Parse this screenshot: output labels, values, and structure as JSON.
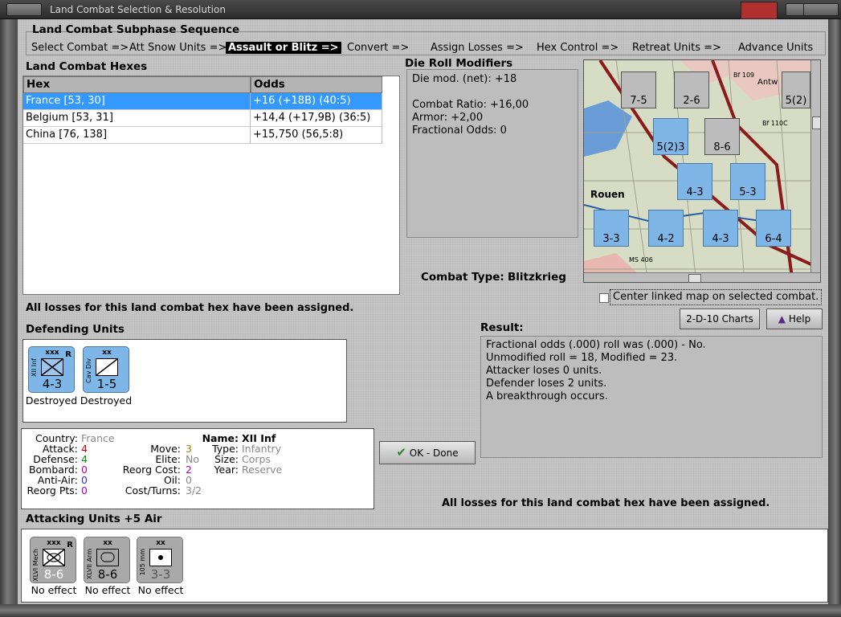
{
  "window": {
    "title": "Land Combat Selection & Resolution"
  },
  "subphase": {
    "heading": "Land Combat Subphase Sequence",
    "steps": [
      "Select Combat =>",
      "Att Snow Units =>",
      "Assault or Blitz =>",
      "Convert =>",
      "Assign Losses =>",
      "Hex Control =>",
      "Retreat Units =>",
      "Advance Units"
    ]
  },
  "hexes": {
    "heading": "Land Combat Hexes",
    "col_hex": "Hex",
    "col_odds": "Odds",
    "rows": [
      {
        "hex": "France [53, 30]",
        "odds": "+16 (+18B) (40:5)"
      },
      {
        "hex": "Belgium [53, 31]",
        "odds": "+14,4 (+17,9B) (36:5)"
      },
      {
        "hex": "China [76, 138]",
        "odds": "+15,750 (56,5:8)"
      }
    ]
  },
  "modifiers": {
    "heading": "Die Roll Modifiers",
    "lines": [
      "Die mod. (net): +18",
      "",
      "Combat Ratio: +16,00",
      "Armor: +2,00",
      "Fractional Odds: 0"
    ]
  },
  "combat_type": {
    "label": "Combat Type:",
    "value": "Blitzkrieg"
  },
  "center_map": {
    "label": "Center linked map on selected combat."
  },
  "buttons": {
    "charts": "2-D-10 Charts",
    "help": "Help",
    "ok": "OK - Done"
  },
  "losses_msg": "All losses for this land combat hex have been assigned.",
  "defending": {
    "heading": "Defending Units",
    "units": [
      {
        "size": "xxx",
        "name": "XII Inf",
        "values": "4-3",
        "result": "Destroyed",
        "mark": "R"
      },
      {
        "size": "xx",
        "name": "Cav Div",
        "values": "1-5",
        "result": "Destroyed",
        "mark": ""
      }
    ]
  },
  "details": {
    "country_l": "Country:",
    "country": "France",
    "attack_l": "Attack:",
    "attack": "4",
    "defense_l": "Defense:",
    "defense": "4",
    "bombard_l": "Bombard:",
    "bombard": "0",
    "aa_l": "Anti-Air:",
    "aa": "0",
    "reorgpts_l": "Reorg Pts:",
    "reorgpts": "0",
    "move_l": "Move:",
    "move": "3",
    "elite_l": "Elite:",
    "elite": "No",
    "reorgcost_l": "Reorg Cost:",
    "reorgcost": "2",
    "oil_l": "Oil:",
    "oil": "0",
    "cost_l": "Cost/Turns:",
    "cost": "3/2",
    "name_l": "Name:",
    "name": "XII Inf",
    "type_l": "Type:",
    "type": "Infantry",
    "size_l": "Size:",
    "size": "Corps",
    "year_l": "Year:",
    "year": "Reserve"
  },
  "result": {
    "heading": "Result:",
    "lines": [
      "Fractional odds (.000) roll was (.000)  - No.",
      "Unmodified roll = 18, Modified = 23.",
      "Attacker loses 0 units.",
      "Defender loses 2 units.",
      "A breakthrough occurs."
    ]
  },
  "attacking": {
    "heading": "Attacking Units +5 Air",
    "units": [
      {
        "size": "xxx",
        "name": "XLVI Mech",
        "values": "8-6",
        "result": "No effect",
        "mark": "R"
      },
      {
        "size": "xx",
        "name": "XLVII Arm",
        "values": "8-6",
        "result": "No effect",
        "mark": ""
      },
      {
        "size": "xx",
        "name": "105 mm",
        "values": "3-3",
        "result": "No effect",
        "mark": ""
      }
    ]
  },
  "map": {
    "labels": [
      "Antw",
      "Bf 109",
      "Bf 110C",
      "Rouen",
      "MS 406"
    ],
    "counters": [
      "7-5",
      "2-6",
      "5(2)3",
      "8-6",
      "4-3",
      "5-3",
      "3-3",
      "4-2",
      "4-3",
      "6-4",
      "5(2)"
    ]
  },
  "colors": {
    "selected": "#3399ff",
    "counter_blue": "#7fb6e8",
    "counter_grey": "#a9a9a9",
    "attack_red": "#d00000",
    "defense_green": "#0a8a0a",
    "zero_purple": "#c000c0"
  }
}
